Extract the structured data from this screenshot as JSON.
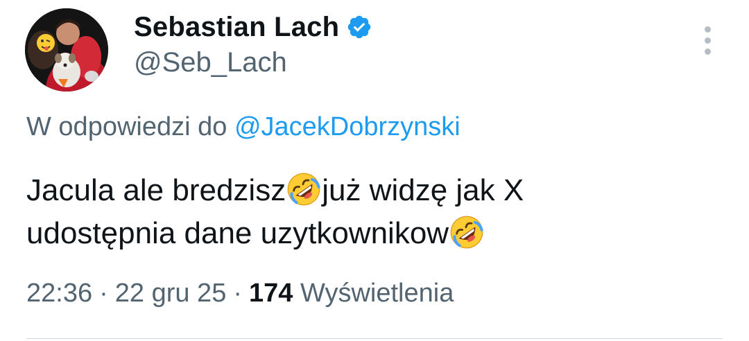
{
  "user": {
    "display_name": "Sebastian Lach",
    "handle": "@Seb_Lach",
    "verified": true,
    "verified_color": "#1d9bf0"
  },
  "reply": {
    "prefix": "W odpowiedzi do ",
    "mention": "@JacekDobrzynski"
  },
  "tweet": {
    "line1_a": "Jacula ale bredzisz",
    "line1_b": "już widzę jak X",
    "line2_a": "udostępnia dane uzytkownikow",
    "emoji": "rolling-on-floor-laughing"
  },
  "meta": {
    "time": "22:36",
    "separator": "·",
    "date": "22 gru 25",
    "views_count": "174",
    "views_label": "Wyświetlenia"
  },
  "colors": {
    "text": "#0f1419",
    "secondary": "#536471",
    "link": "#1d9bf0",
    "divider": "#cfd9de"
  }
}
